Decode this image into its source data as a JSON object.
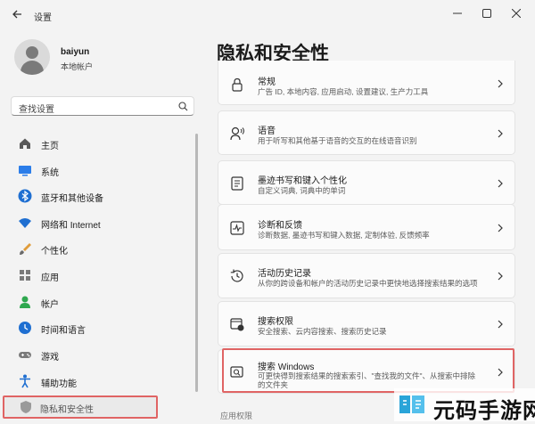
{
  "window": {
    "title": "设置"
  },
  "profile": {
    "name": "baiyun",
    "account_type": "本地帐户"
  },
  "search": {
    "placeholder": "查找设置"
  },
  "nav": {
    "items": [
      {
        "label": "主页",
        "icon": "home-icon"
      },
      {
        "label": "系统",
        "icon": "monitor-icon"
      },
      {
        "label": "蓝牙和其他设备",
        "icon": "bluetooth-icon"
      },
      {
        "label": "网络和 Internet",
        "icon": "wifi-icon"
      },
      {
        "label": "个性化",
        "icon": "brush-icon"
      },
      {
        "label": "应用",
        "icon": "apps-icon"
      },
      {
        "label": "帐户",
        "icon": "person-icon"
      },
      {
        "label": "时间和语言",
        "icon": "globe-clock-icon"
      },
      {
        "label": "游戏",
        "icon": "gamepad-icon"
      },
      {
        "label": "辅助功能",
        "icon": "accessibility-icon"
      },
      {
        "label": "隐私和安全性",
        "icon": "shield-icon",
        "selected": true
      }
    ]
  },
  "main": {
    "title": "隐私和安全性",
    "cards": [
      {
        "title": "常规",
        "desc": "广告 ID, 本地内容, 应用启动, 设置建议, 生产力工具",
        "icon": "lock-icon"
      },
      {
        "title": "语音",
        "desc": "用于听写和其他基于语音的交互的在线语音识别",
        "icon": "speech-icon"
      },
      {
        "title": "墨迹书写和键入个性化",
        "desc": "自定义词典, 词典中的单词",
        "icon": "notepad-icon"
      },
      {
        "title": "诊断和反馈",
        "desc": "诊断数据, 墨迹书写和键入数据, 定制体验, 反馈频率",
        "icon": "pulse-icon"
      },
      {
        "title": "活动历史记录",
        "desc": "从你的跨设备和帐户的活动历史记录中更快地选择搜索结果的选项",
        "icon": "history-icon"
      },
      {
        "title": "搜索权限",
        "desc": "安全搜索、云内容搜索、搜索历史记录",
        "icon": "search-permission-icon"
      },
      {
        "title": "搜索 Windows",
        "desc": "可更快得到搜索结果的搜索索引、\"查找我的文件\"、从搜索中排除",
        "desc2": "的文件夹",
        "icon": "search-windows-icon",
        "highlighted": true
      }
    ],
    "section_label": "应用权限"
  },
  "watermark": {
    "text": "元码手游网"
  },
  "colors": {
    "highlight_border": "#e06464",
    "accent_blue": "#0067c0",
    "background": "#f3f3f3"
  }
}
